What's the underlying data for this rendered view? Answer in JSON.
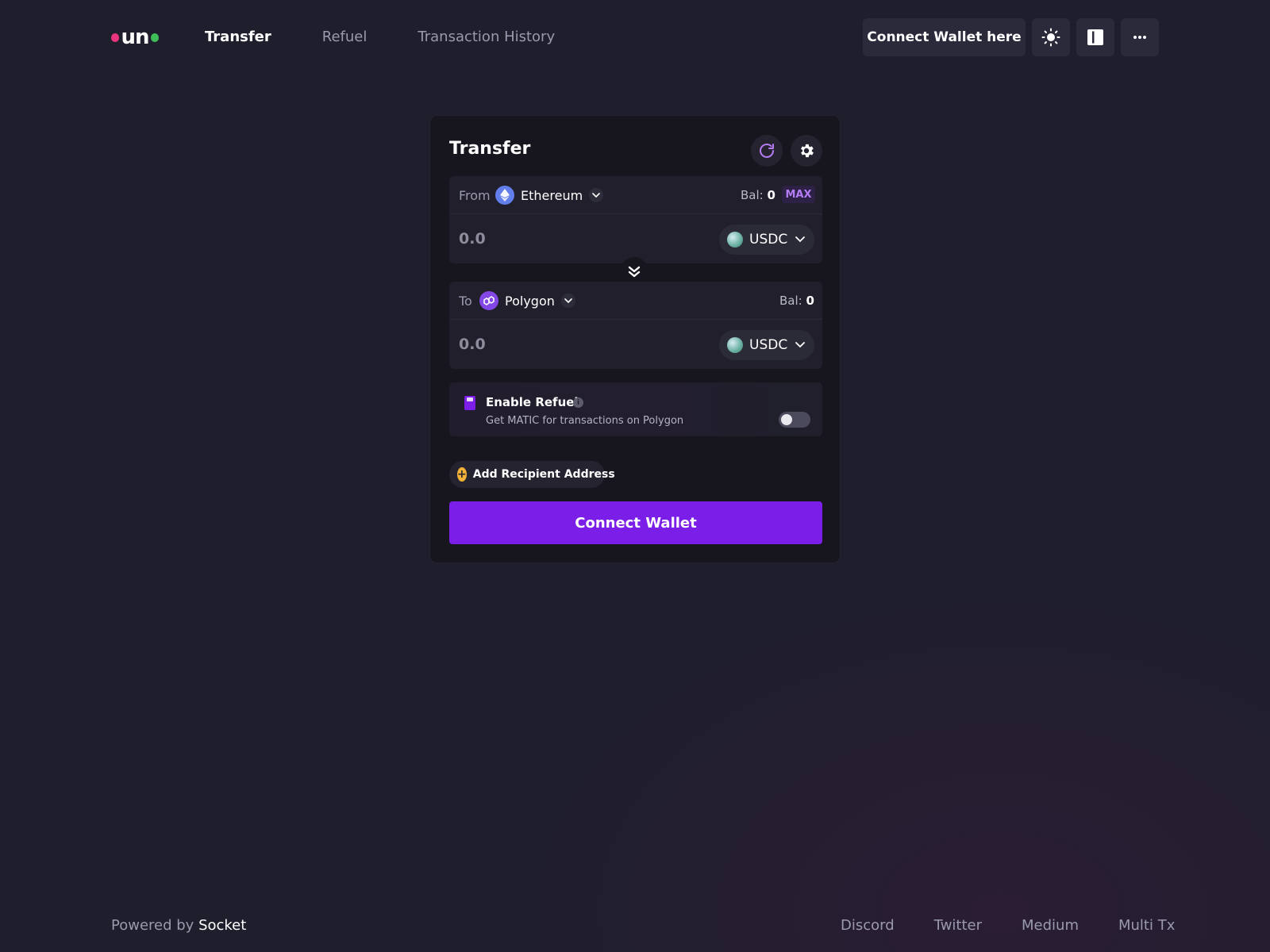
{
  "logo": {
    "mark": "un"
  },
  "nav": {
    "items": [
      {
        "label": "Transfer",
        "active": true
      },
      {
        "label": "Refuel",
        "active": false
      },
      {
        "label": "Transaction History",
        "active": false
      }
    ]
  },
  "header": {
    "connect_label": "Connect Wallet here",
    "theme_icon": "sun-icon",
    "layout_icon": "layout-icon",
    "more_icon": "ellipsis-icon"
  },
  "card": {
    "title": "Transfer",
    "from": {
      "label": "From",
      "chain": "Ethereum",
      "bal_label": "Bal:",
      "bal_value": "0",
      "max_label": "MAX",
      "amount_placeholder": "0.0",
      "token": "USDC"
    },
    "to": {
      "label": "To",
      "chain": "Polygon",
      "bal_label": "Bal:",
      "bal_value": "0",
      "amount_placeholder": "0.0",
      "token": "USDC"
    },
    "refuel": {
      "title": "Enable Refuel",
      "description": "Get MATIC for transactions on Polygon",
      "enabled": false
    },
    "recipient_label": "Add Recipient Address",
    "connect_label": "Connect Wallet"
  },
  "footer": {
    "powered_by": "Powered by",
    "brand": "Socket",
    "links": [
      "Discord",
      "Twitter",
      "Medium",
      "Multi Tx"
    ]
  },
  "colors": {
    "background": "#1f1e2c",
    "card": "#17161f",
    "accent": "#7a1ee8",
    "ethereum": "#627eea",
    "polygon": "#8247e5"
  }
}
